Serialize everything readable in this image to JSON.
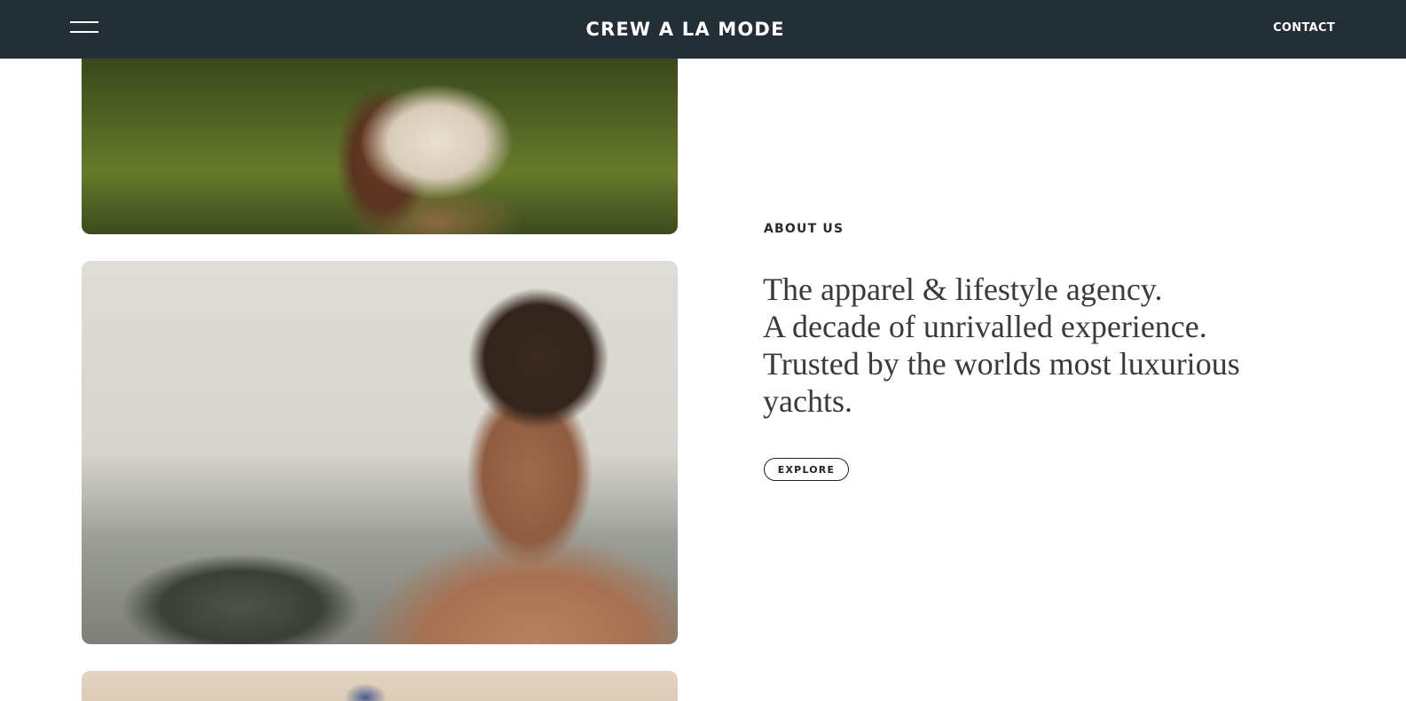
{
  "header": {
    "brand": "CREW A LA MODE",
    "contact_label": "CONTACT"
  },
  "about": {
    "label": "ABOUT US",
    "lines": [
      "The apparel & lifestyle agency.",
      "A decade of unrivalled experience.",
      "Trusted by the worlds most luxurious",
      "yachts."
    ],
    "explore_label": "EXPLORE"
  },
  "colors": {
    "header_bg": "#222f36",
    "header_text": "#ffffff",
    "body_text": "#3a3a3a"
  },
  "icons": {
    "menu": "hamburger-menu-icon"
  }
}
